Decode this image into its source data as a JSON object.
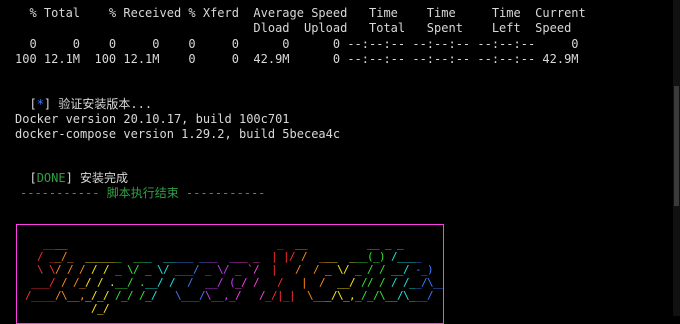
{
  "curl": {
    "header1": "  % Total    % Received % Xferd  Average Speed   Time    Time     Time  Current",
    "header2": "                                 Dload  Upload   Total   Spent    Left  Speed",
    "row1": "  0     0    0     0    0     0      0      0 --:--:-- --:--:-- --:--:--     0",
    "row2": "100 12.1M  100 12.1M    0     0  42.9M      0 --:--:-- --:--:-- --:--:-- 42.9M"
  },
  "verify": {
    "bracket_open": "[",
    "star": "*",
    "bracket_close": "]",
    "text": " 验证安装版本..."
  },
  "docker_version": "Docker version 20.10.17, build 100c701",
  "compose_version": "docker-compose version 1.29.2, build 5becea4c",
  "done": {
    "bracket_open": "[",
    "tag": "DONE",
    "bracket_close": "]",
    "text": " 安装完成"
  },
  "separator": "----------- 脚本执行结束 -----------",
  "colors": {
    "background": "#000000",
    "text": "#d8d8d8",
    "info_star": "#3a7bff",
    "done": "#2ea043",
    "banner_border": "#ff3eea",
    "rainbow": [
      "#ff2d2d",
      "#ff8c1a",
      "#ffe81a",
      "#33e833",
      "#1ae8e8",
      "#3a7bff",
      "#c93aff",
      "#ff3eea"
    ]
  },
  "banner_art": [
    "   ____                                   _  __          __ _ _",
    "  / __/_  ______  ___  _____ ___  ___ _  | |/ /  ___  ___(_) /____",
    "  \\ \\/ / / / / _ \\/ _ \\/ ___/ _ \\/ _ `/  |   /  / _ \\/ _ / / __/ -_)",
    " ___/ / /_/ / .__/ .__/ /  /  __/ (_/ /   /   |  /  __/ // / / /__/\\__/",
    "/____/\\__,_/_/ /_/ /_/   \\___/\\__,_/   /_/|_|  \\___/\\_,_/_/\\__/\\___/",
    "           /_/"
  ]
}
